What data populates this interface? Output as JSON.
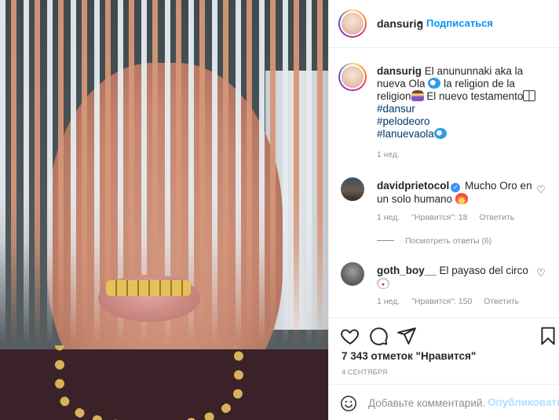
{
  "post": {
    "image_alt": "Photo: face covered by chains of diamonds and gold, gold grill on teeth"
  },
  "header": {
    "username": "dansurig",
    "dot": "•",
    "follow_label": "Подписаться"
  },
  "caption": {
    "username": "dansurig",
    "text_1": "El anununnaki aka la nueva Ola",
    "text_2": "la religion de la religion",
    "text_3": "El nuevo testamento",
    "hashtags": [
      "#dansur",
      "#pelodeoro",
      "#lanuevaola"
    ],
    "time": "1 нед."
  },
  "comments": [
    {
      "username": "davidprietocol",
      "verified": true,
      "text": "Mucho Oro en un solo humano",
      "time": "1 нед.",
      "likes": "\"Нравится\": 18",
      "reply": "Ответить",
      "view_replies": "Посмотреть ответы (6)"
    },
    {
      "username": "goth_boy__",
      "verified": false,
      "text": "El payaso del circo",
      "time": "1 нед.",
      "likes": "\"Нравится\": 150",
      "reply": "Ответить"
    }
  ],
  "actions": {
    "likes_count": "7 343 отметок \"Нравится\"",
    "date": "4 СЕНТЯБРЯ"
  },
  "add_comment": {
    "placeholder": "Добавьте комментарий...",
    "post_label": "Опубликовать"
  },
  "colors": {
    "link_blue": "#0095f6",
    "hashtag": "#00376b",
    "muted": "#8e8e8e"
  }
}
